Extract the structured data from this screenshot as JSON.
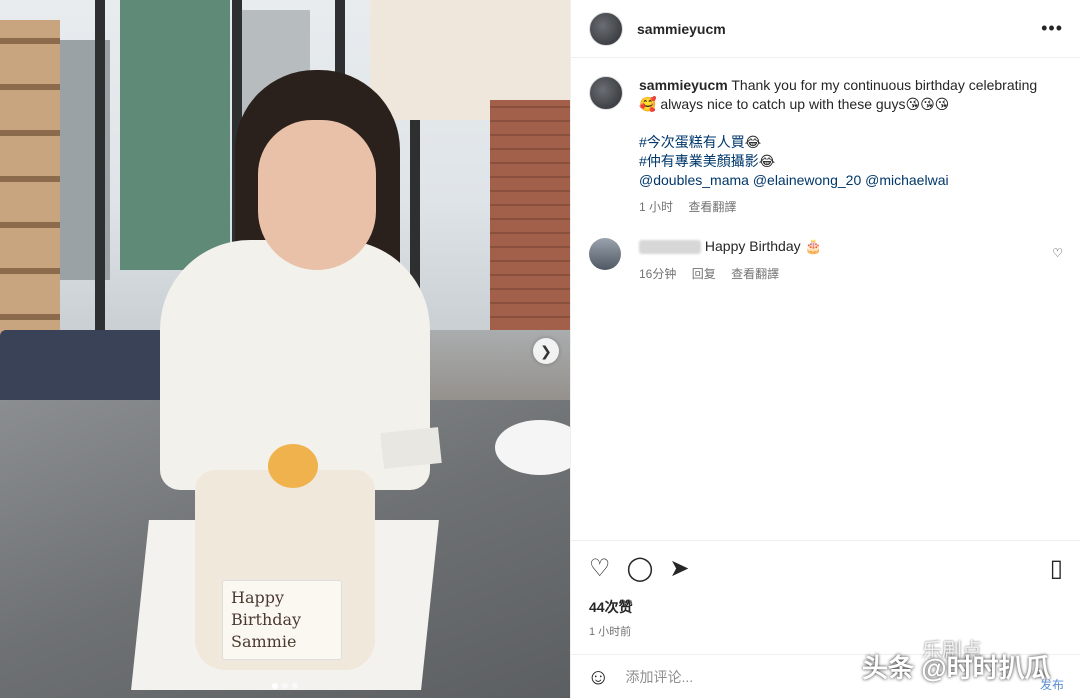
{
  "post": {
    "username": "sammieyucm",
    "caption_line1": "Thank you for my continuous birthday celebrating",
    "caption_line2": "always nice to catch up with these guys",
    "hashtag1": "#今次蛋糕有人買",
    "hashtag2": "#仲有專業美顏攝影",
    "mention1": "@doubles_mama",
    "mention2": "@elainewong_20",
    "mention3": "@michaelwai",
    "caption_time": "1 小时",
    "see_translation": "查看翻譯",
    "cake_text": "Happy Birthday Sammie",
    "emoji_face": "🥰",
    "emoji_kiss": "😘😘😘",
    "emoji_laugh": "😂"
  },
  "comment": {
    "text": "Happy Birthday",
    "emoji": "🎂",
    "time": "16分钟",
    "reply": "回复",
    "translate": "查看翻譯"
  },
  "footer": {
    "likes": "44次赞",
    "time": "1 小时前",
    "add_comment_placeholder": "添加评论..."
  },
  "watermark": {
    "top": "乐剧点",
    "main": "头条 @时时扒瓜",
    "small": "发布"
  },
  "icons": {
    "more": "more-horizontal-icon",
    "heart": "heart-icon",
    "comment": "comment-icon",
    "share": "share-icon",
    "save": "bookmark-icon",
    "emoji": "emoji-icon",
    "next": "chevron-right-icon"
  }
}
